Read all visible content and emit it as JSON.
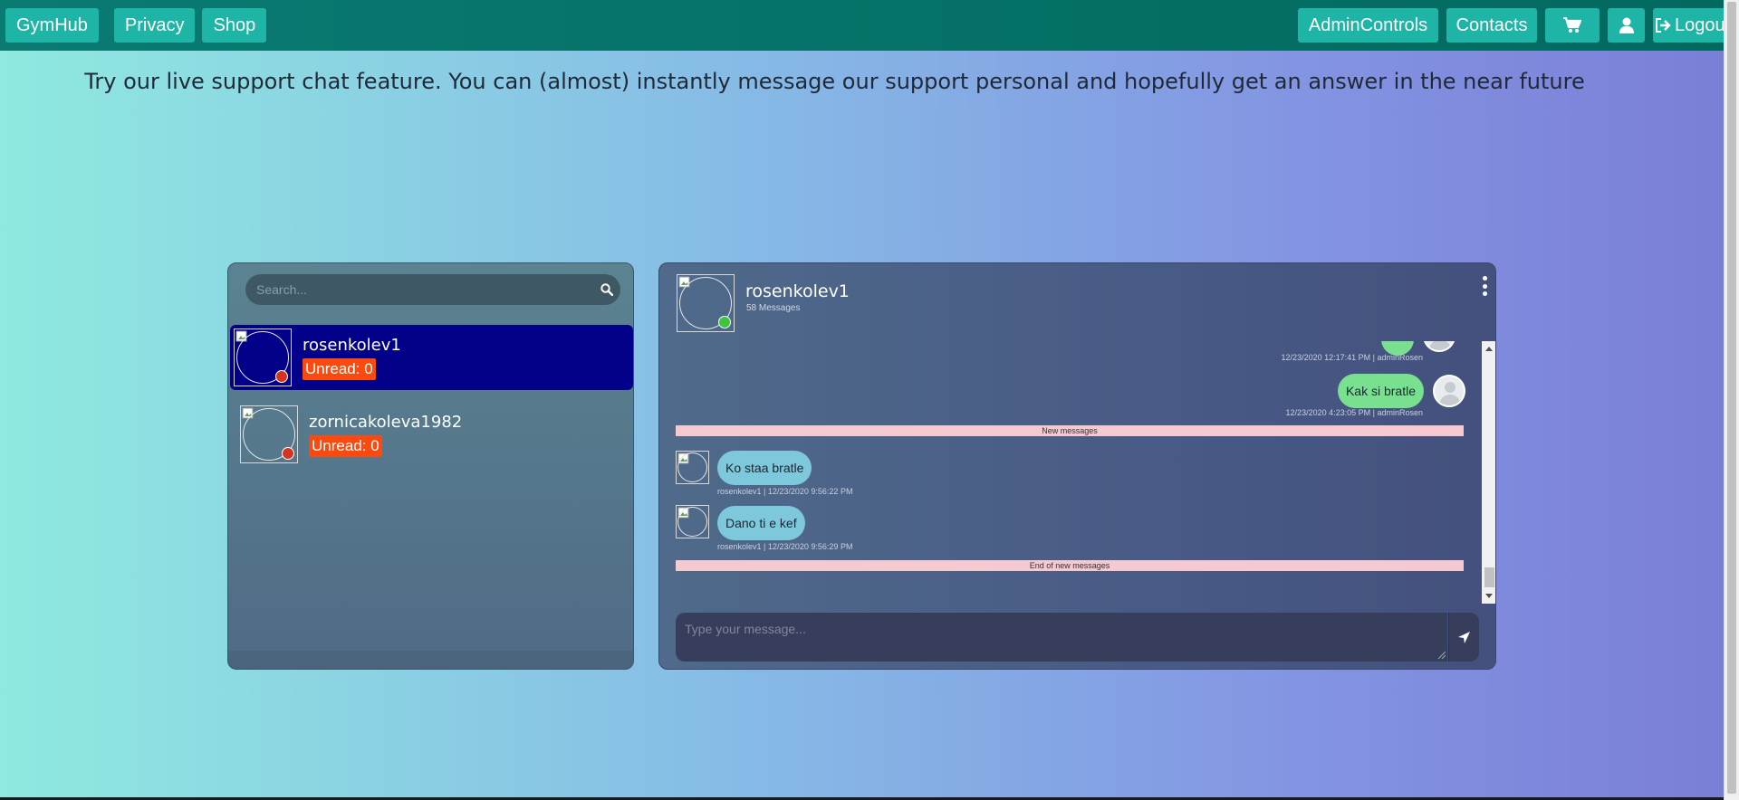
{
  "navbar": {
    "brand": "GymHub",
    "links": [
      "Privacy",
      "Shop"
    ],
    "admin_label": "AdminControls",
    "contacts_label": "Contacts",
    "cart_icon": "cart-icon",
    "user_icon": "user-icon",
    "logout_label": "Logout"
  },
  "headline": "Try our live support chat feature. You can (almost) instantly message our support personal and hopefully get an answer in the near future",
  "contacts": {
    "search_placeholder": "Search...",
    "items": [
      {
        "name": "rosenkolev1",
        "unread": "Unread: 0",
        "status": "offline",
        "active": true
      },
      {
        "name": "zornicakoleva1982",
        "unread": "Unread: 0",
        "status": "offline",
        "active": false
      }
    ]
  },
  "chat": {
    "title": "rosenkolev1",
    "message_count": "58 Messages",
    "messages": [
      {
        "dir": "out",
        "text": "",
        "meta": "12/23/2020 12:17:41 PM | adminRosen"
      },
      {
        "dir": "out",
        "text": "Kak si bratle",
        "meta": "12/23/2020 4:23:05 PM | adminRosen"
      },
      {
        "dir": "in",
        "text": "Ko staa bratle",
        "meta": "rosenkolev1 | 12/23/2020 9:56:22 PM"
      },
      {
        "dir": "in",
        "text": "Dano ti e kef",
        "meta": "rosenkolev1 | 12/23/2020 9:56:29 PM"
      }
    ],
    "new_messages_label": "New messages",
    "end_new_messages_label": "End of new messages",
    "input_placeholder": "Type your message...",
    "colors": {
      "outgoing": "#78e08f",
      "incoming": "#7ec8dc",
      "active_contact": "#03008a",
      "unread_badge": "#fa4a0f"
    }
  }
}
